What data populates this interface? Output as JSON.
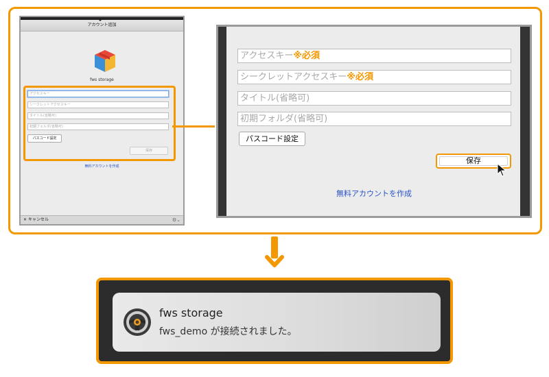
{
  "mini_dialog": {
    "title": "アカウント追加",
    "app_name": "fws storage",
    "fields": [
      {
        "placeholder": "アクセスキー"
      },
      {
        "placeholder": "シークレットアクセスキー"
      },
      {
        "placeholder": "タイトル(省略可)"
      },
      {
        "placeholder": "初期フォルダ(省略可)"
      }
    ],
    "passcode_button": "パスコード設定",
    "save_button": "保存",
    "create_account_link": "無料アカウントを作成",
    "cancel_label": "キャンセル"
  },
  "zoom": {
    "fields": [
      {
        "placeholder": "アクセスキー",
        "required": "※必須"
      },
      {
        "placeholder": "シークレットアクセスキー",
        "required": "※必須"
      },
      {
        "placeholder": "タイトル(省略可)",
        "required": ""
      },
      {
        "placeholder": "初期フォルダ(省略可)",
        "required": ""
      }
    ],
    "passcode_button": "パスコード設定",
    "save_button": "保存",
    "create_account_link": "無料アカウントを作成"
  },
  "notification": {
    "title": "fws storage",
    "body": "fws_demo が接続されました。"
  },
  "colors": {
    "accent": "#f39800",
    "link": "#2a52c9"
  },
  "icons": [
    "cube-logo-icon",
    "close-icon",
    "gear-icon",
    "cursor-icon",
    "arrow-down-icon",
    "steering-wheel-icon"
  ]
}
